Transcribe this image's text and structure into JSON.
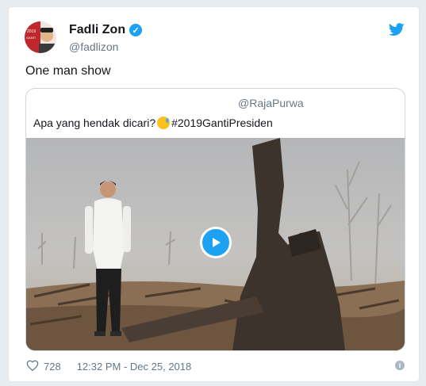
{
  "author": {
    "name": "Fadli Zon",
    "handle": "@fadlizon"
  },
  "tweet": {
    "text": "One man show"
  },
  "quoted": {
    "handle": "@RajaPurwa",
    "text": "Apa yang hendak dicari?",
    "hashtag": "#2019GantiPresiden"
  },
  "footer": {
    "likes": "728",
    "timestamp": "12:32 PM - Dec 25, 2018"
  },
  "colors": {
    "accent": "#1da1f2",
    "text": "#14171a",
    "muted": "#657786"
  },
  "icons": {
    "verified": "verified-badge-icon",
    "bird": "twitter-bird-icon",
    "heart": "heart-icon",
    "play": "play-icon",
    "info": "info-icon"
  }
}
